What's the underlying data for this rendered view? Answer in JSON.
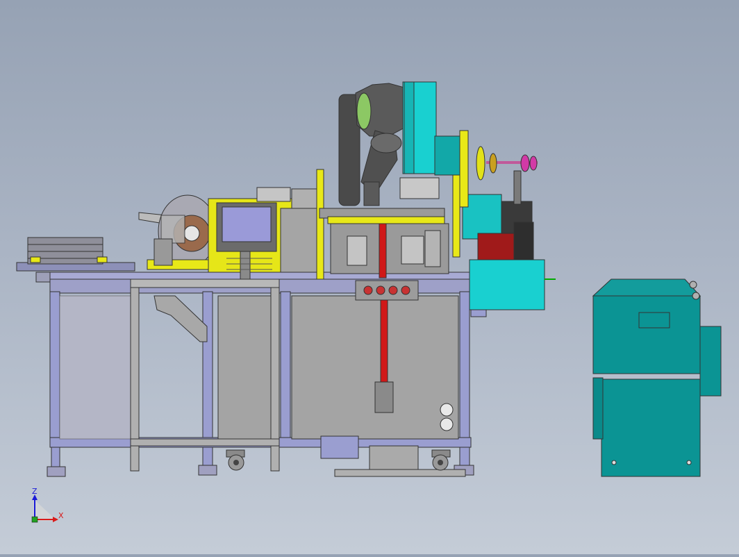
{
  "scene": {
    "type": "cad-3d-model-view",
    "colors": {
      "background_top": "#96a2b4",
      "background_bottom": "#c4ccd7",
      "frame": "#9a9ed0",
      "panel": "#a4a4a4",
      "cabinet": "#0b9494",
      "accent_cyan": "#19d0d0",
      "accent_yellow": "#f0f018",
      "robot_dark": "#4a4a4a",
      "robot_green": "#8cc864"
    }
  },
  "triad": {
    "z_label": "Z",
    "x_label": "X"
  }
}
